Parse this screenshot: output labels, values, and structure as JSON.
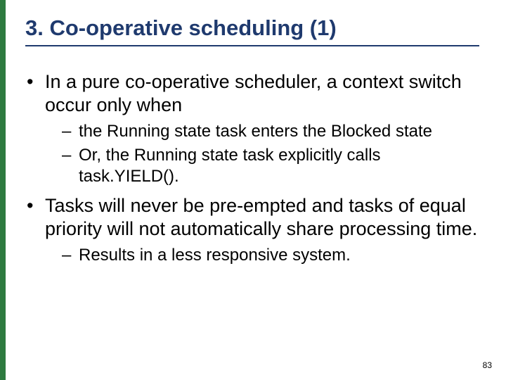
{
  "title": "3. Co-operative scheduling (1)",
  "bullets": [
    {
      "text": "In a pure co-operative scheduler, a context switch occur only when",
      "sub": [
        "the Running state task enters the Blocked state",
        "Or,  the Running state task explicitly calls task.YIELD()."
      ]
    },
    {
      "text": "Tasks will never be pre-empted and tasks of equal priority will not automatically share processing time.",
      "sub": [
        "Results in a less responsive system."
      ]
    }
  ],
  "page_number": "83"
}
